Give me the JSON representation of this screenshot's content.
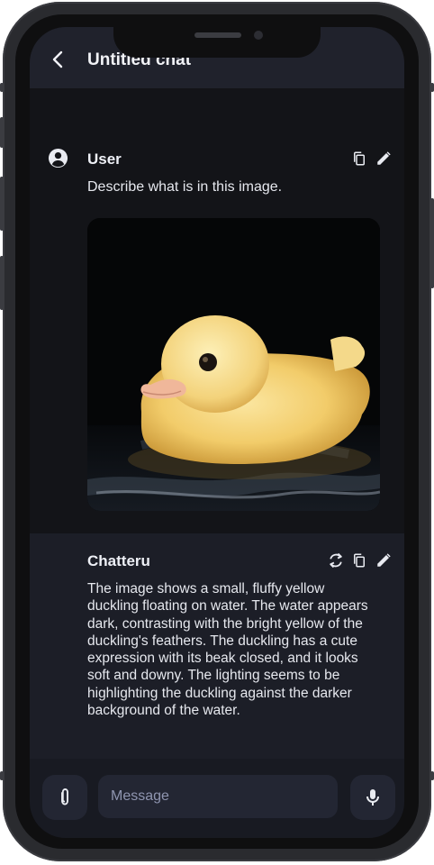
{
  "header": {
    "title": "Untitled chat",
    "back_icon": "chevron-left-icon"
  },
  "user_message": {
    "author": "User",
    "text": "Describe what is in this image.",
    "avatar_icon": "account-circle-icon",
    "actions": [
      "copy-icon",
      "edit-icon"
    ],
    "image": "yellow duckling floating on dark water"
  },
  "bot_message": {
    "author": "Chatteru",
    "text": "The image shows a small, fluffy yellow duckling floating on water. The water appears dark, contrasting with the bright yellow of the duckling's feathers. The duckling has a cute expression with its beak closed, and it looks soft and downy. The lighting seems to be highlighting the duckling against the darker background of the water.",
    "actions": [
      "regenerate-icon",
      "copy-icon",
      "edit-icon"
    ]
  },
  "composer": {
    "placeholder": "Message",
    "attach_icon": "paperclip-icon",
    "mic_icon": "microphone-icon"
  },
  "colors": {
    "background": "#131418",
    "header": "#20222c",
    "bot_bubble": "#1c1e27",
    "input": "#232633",
    "text": "#e6e8ee"
  }
}
